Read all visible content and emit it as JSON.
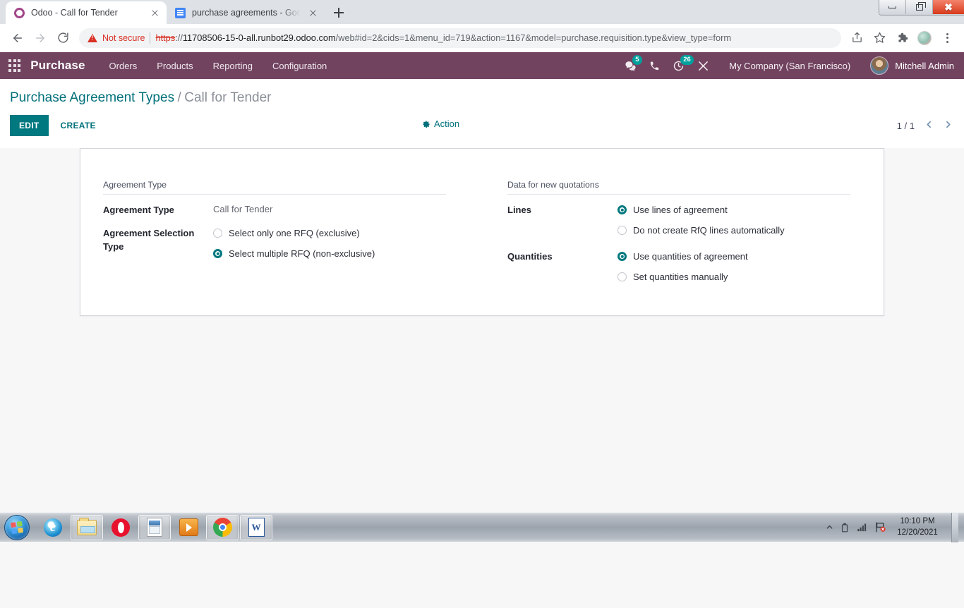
{
  "browser": {
    "tabs": [
      {
        "title": "Odoo - Call for Tender",
        "icon": "odoo-favicon",
        "active": true
      },
      {
        "title": "purchase agreements - Google D",
        "icon": "google-docs-favicon",
        "active": false
      }
    ],
    "new_tab_label": "+",
    "security_label": "Not secure",
    "url": {
      "scheme": "https",
      "separator": "://",
      "host": "11708506-15-0-all.runbot29.odoo.com",
      "path": "/web#id=2&cids=1&menu_id=719&action=1167&model=purchase.requisition.type&view_type=form",
      "full": "https://11708506-15-0-all.runbot29.odoo.com/web#id=2&cids=1&menu_id=719&action=1167&model=purchase.requisition.type&view_type=form"
    },
    "window_controls": {
      "minimize": "–",
      "restore": "❐",
      "close": "✕"
    }
  },
  "odoo": {
    "brand": "Purchase",
    "menus": [
      {
        "label": "Orders"
      },
      {
        "label": "Products"
      },
      {
        "label": "Reporting"
      },
      {
        "label": "Configuration"
      }
    ],
    "systray": {
      "messages_badge": "5",
      "activities_badge": "26",
      "company": "My Company (San Francisco)",
      "user": "Mitchell Admin"
    },
    "breadcrumb": {
      "parent": "Purchase Agreement Types",
      "separator": "/",
      "current": "Call for Tender"
    },
    "controls": {
      "edit": "EDIT",
      "create": "CREATE",
      "action": "Action",
      "pager": "1 / 1",
      "prev": "‹",
      "next": "›"
    },
    "form": {
      "left_group": {
        "title": "Agreement Type",
        "fields": [
          {
            "label": "Agreement Type",
            "type": "text",
            "value": "Call for Tender"
          },
          {
            "label": "Agreement Selection Type",
            "type": "radio",
            "options": [
              {
                "label": "Select only one RFQ (exclusive)",
                "selected": false
              },
              {
                "label": "Select multiple RFQ (non-exclusive)",
                "selected": true
              }
            ]
          }
        ]
      },
      "right_group": {
        "title": "Data for new quotations",
        "fields": [
          {
            "label": "Lines",
            "type": "radio",
            "options": [
              {
                "label": "Use lines of agreement",
                "selected": true
              },
              {
                "label": "Do not create RfQ lines automatically",
                "selected": false
              }
            ]
          },
          {
            "label": "Quantities",
            "type": "radio",
            "options": [
              {
                "label": "Use quantities of agreement",
                "selected": true
              },
              {
                "label": "Set quantities manually",
                "selected": false
              }
            ]
          }
        ]
      }
    },
    "colors": {
      "navbar": "#71435f",
      "accent": "#00787f",
      "badge": "#00a09d"
    }
  },
  "taskbar": {
    "items": [
      {
        "name": "internet-explorer",
        "open": false
      },
      {
        "name": "windows-explorer",
        "open": true
      },
      {
        "name": "opera",
        "open": false
      },
      {
        "name": "document",
        "open": true
      },
      {
        "name": "media-player",
        "open": false
      },
      {
        "name": "google-chrome",
        "open": true
      },
      {
        "name": "microsoft-word",
        "open": true
      }
    ],
    "clock_time": "10:10 PM",
    "clock_date": "12/20/2021"
  }
}
